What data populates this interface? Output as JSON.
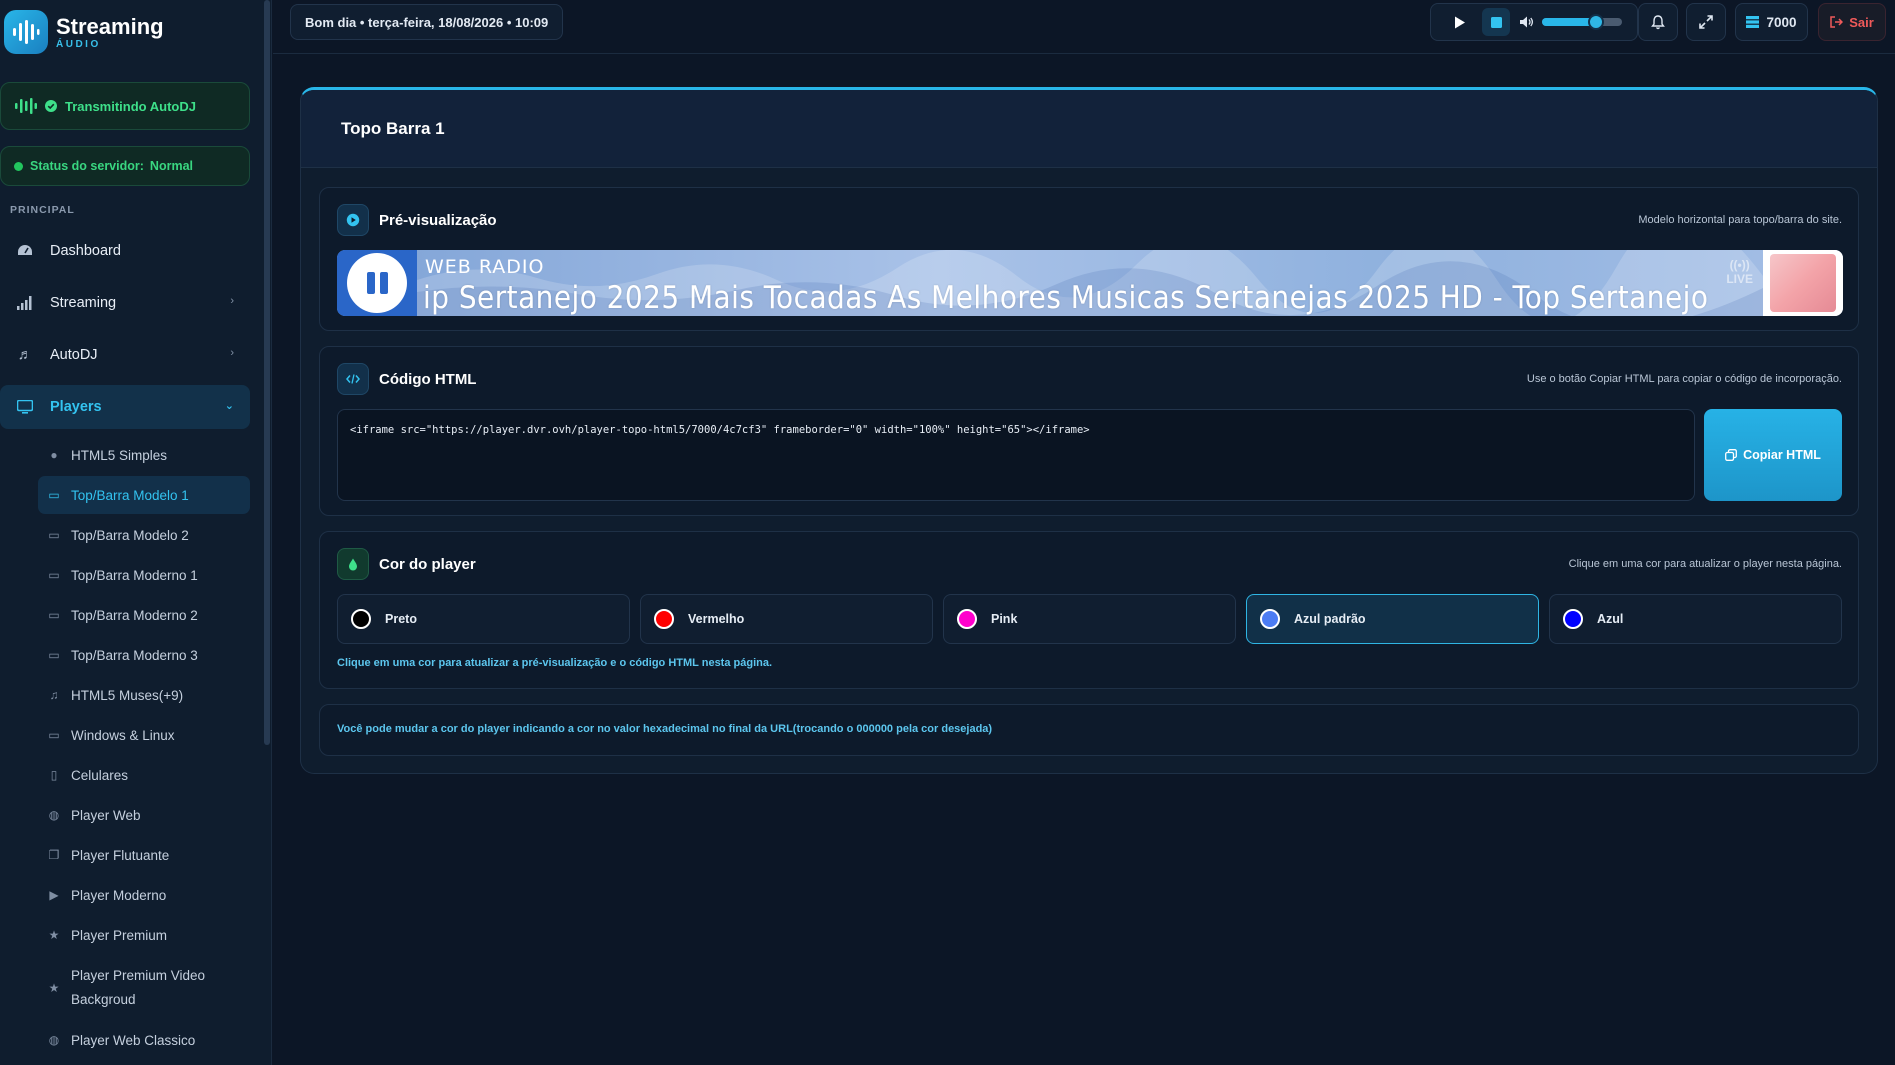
{
  "brand": {
    "title": "Streaming",
    "subtitle": "ÁUDIO"
  },
  "sidebar": {
    "autodj_status": "Transmitindo AutoDJ",
    "server_status_label": "Status do servidor:",
    "server_status_value": "Normal",
    "section_label": "PRINCIPAL",
    "nav": [
      {
        "label": "Dashboard",
        "icon": "gauge-icon"
      },
      {
        "label": "Streaming",
        "icon": "signal-icon"
      },
      {
        "label": "AutoDJ",
        "icon": "music-icon"
      },
      {
        "label": "Players",
        "icon": "monitor-icon"
      }
    ],
    "players_sub": [
      {
        "label": "HTML5 Simples",
        "icon": "play-circle-icon"
      },
      {
        "label": "Top/Barra Modelo 1",
        "icon": "window-icon"
      },
      {
        "label": "Top/Barra Modelo 2",
        "icon": "window-icon"
      },
      {
        "label": "Top/Barra Moderno 1",
        "icon": "desktop-icon"
      },
      {
        "label": "Top/Barra Moderno 2",
        "icon": "desktop-icon"
      },
      {
        "label": "Top/Barra Moderno 3",
        "icon": "desktop-icon"
      },
      {
        "label": "HTML5 Muses(+9)",
        "icon": "music-icon"
      },
      {
        "label": "Windows & Linux",
        "icon": "desktop-icon"
      },
      {
        "label": "Celulares",
        "icon": "mobile-icon"
      },
      {
        "label": "Player Web",
        "icon": "globe-icon"
      },
      {
        "label": "Player Flutuante",
        "icon": "copy-icon"
      },
      {
        "label": "Player Moderno",
        "icon": "play-icon"
      },
      {
        "label": "Player Premium",
        "icon": "star-icon"
      },
      {
        "label": "Player Premium Video Backgroud",
        "icon": "star-icon"
      },
      {
        "label": "Player Web Classico",
        "icon": "globe-icon"
      }
    ]
  },
  "topbar": {
    "greeting": "Bom dia • terça-feira, 18/08/2026 • 10:09",
    "volume_level": 0.68,
    "port": "7000",
    "logout": "Sair"
  },
  "main": {
    "title": "Topo Barra 1",
    "preview": {
      "title": "Pré-visualização",
      "hint": "Modelo horizontal para topo/barra do site.",
      "banner_label": "WEB RADIO",
      "banner_track": "ip Sertanejo 2025 Mais Tocadas As Melhores Musicas Sertanejas 2025 HD - Top Sertanejo",
      "banner_live": "LIVE"
    },
    "code": {
      "title": "Código HTML",
      "hint": "Use o botão Copiar HTML para copiar o código de incorporação.",
      "value": "<iframe src=\"https://player.dvr.ovh/player-topo-html5/7000/4c7cf3\" frameborder=\"0\" width=\"100%\" height=\"65\"></iframe>",
      "copy_label": "Copiar HTML"
    },
    "color": {
      "title": "Cor do player",
      "hint": "Clique em uma cor para atualizar o player nesta página.",
      "options": [
        {
          "label": "Preto",
          "color": "#000000"
        },
        {
          "label": "Vermelho",
          "color": "#ff0000"
        },
        {
          "label": "Pink",
          "color": "#ff00cc"
        },
        {
          "label": "Azul padrão",
          "color": "#4c7cf3"
        },
        {
          "label": "Azul",
          "color": "#0000ff"
        }
      ],
      "selected": "Azul padrão",
      "footer": "Clique em uma cor para atualizar a pré-visualização e o código HTML nesta página."
    },
    "note": "Você pode mudar a cor do player indicando a cor no valor hexadecimal no final da URL(trocando o 000000 pela cor desejada)"
  }
}
